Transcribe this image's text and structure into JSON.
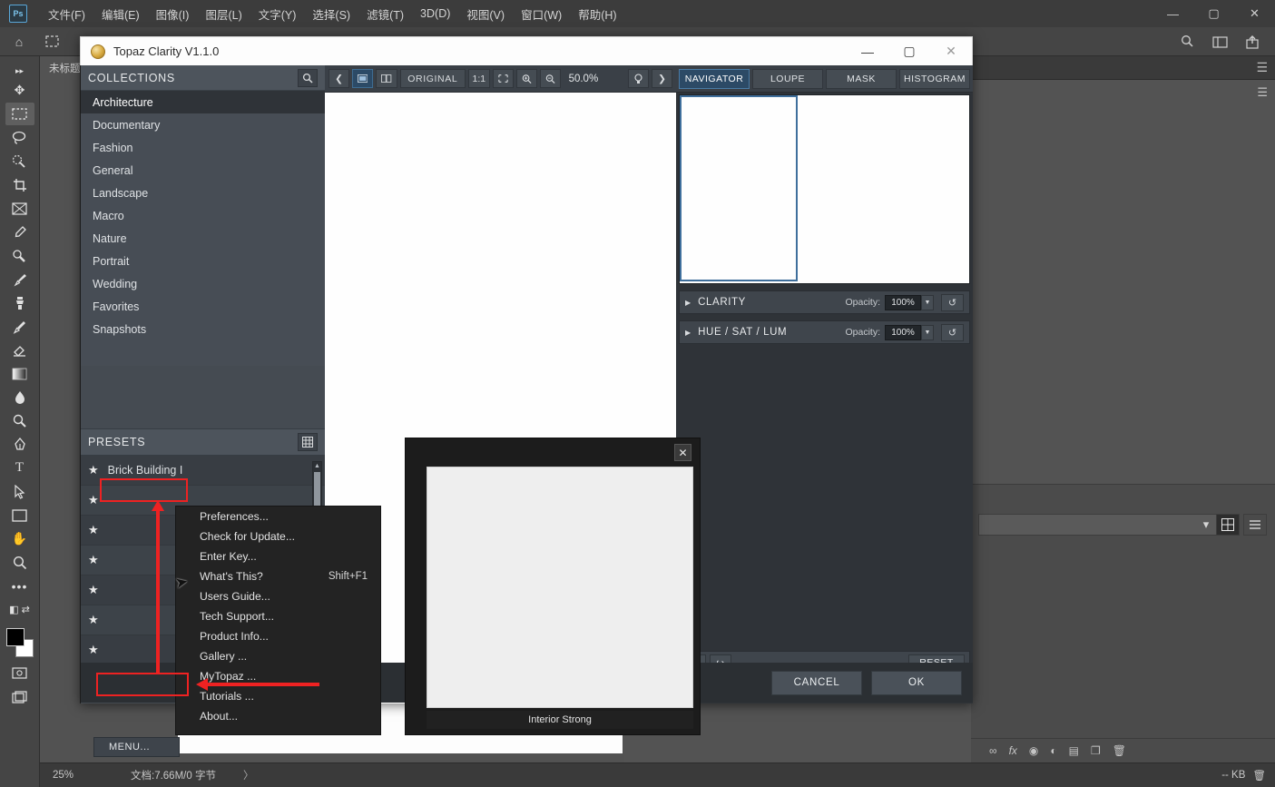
{
  "photoshop": {
    "logo_text": "Ps",
    "menu_items": [
      "文件(F)",
      "编辑(E)",
      "图像(I)",
      "图层(L)",
      "文字(Y)",
      "选择(S)",
      "滤镜(T)",
      "3D(D)",
      "视图(V)",
      "窗口(W)",
      "帮助(H)"
    ],
    "window_controls": {
      "minimize": "—",
      "maximize": "▢",
      "close": "✕"
    },
    "option_bar": {
      "home_icon": "home-icon",
      "marquee_icon": "marquee-icon",
      "dots": "••"
    },
    "tab_title": "未标题",
    "tab_right_icon": "panel-menu-icon",
    "toolbar_icons": [
      "move-tool",
      "rectangular-marquee-tool",
      "lasso-tool",
      "quick-selection-tool",
      "crop-tool",
      "frame-tool",
      "eyedropper-tool",
      "spot-healing-brush-tool",
      "brush-tool",
      "clone-stamp-tool",
      "history-brush-tool",
      "eraser-tool",
      "gradient-tool",
      "blur-tool",
      "dodge-tool",
      "pen-tool",
      "type-tool",
      "path-selection-tool",
      "shape-tool",
      "hand-tool",
      "zoom-tool",
      "more-tools"
    ],
    "option_right_icons": [
      "search-icon",
      "arrange-icon",
      "share-icon"
    ],
    "statusbar": {
      "zoom": "25%",
      "doc_info": "文档:7.66M/0 字节",
      "arrow": "〉",
      "right_label": "-- KB",
      "right_icon": "trash-icon"
    },
    "right_panel": {
      "menu_icon": "panel-options-icon",
      "select_value": "",
      "grid_view_icon": "grid-view-icon",
      "list_view_icon": "list-view-icon",
      "row_labels": [
        "",
        ""
      ],
      "footer_icons": [
        "link-layers-icon",
        "layer-style-icon",
        "layer-mask-icon",
        "adjustment-layer-icon",
        "new-group-icon",
        "new-layer-icon",
        "delete-layer-icon"
      ]
    }
  },
  "topaz": {
    "title": "Topaz Clarity V1.1.0",
    "title_icon": "topaz-logo-icon",
    "window_controls": {
      "minimize": "—",
      "maximize": "▢",
      "close": "✕"
    },
    "collections": {
      "header": "COLLECTIONS",
      "search_icon": "search-icon",
      "items": [
        "Architecture",
        "Documentary",
        "Fashion",
        "General",
        "Landscape",
        "Macro",
        "Nature",
        "Portrait",
        "Wedding",
        "Favorites",
        "Snapshots"
      ],
      "selected_index": 0
    },
    "presets": {
      "header": "PRESETS",
      "grid_icon": "grid-view-icon",
      "items": [
        {
          "name": "Brick Building I",
          "star": "★"
        },
        {
          "name": "",
          "star": "★"
        },
        {
          "name": "",
          "star": "★"
        },
        {
          "name": "",
          "star": "★"
        },
        {
          "name": "",
          "star": "★"
        },
        {
          "name": "",
          "star": "★"
        },
        {
          "name": "",
          "star": "★"
        },
        {
          "name": "",
          "star": "★"
        }
      ],
      "footer_buttons": [
        "save-preset-icon",
        "delete-preset-icon"
      ]
    },
    "image_toolbar": {
      "prev_icon": "chevron-left-icon",
      "single_view_icon": "single-view-icon",
      "split_view_icon": "split-view-icon",
      "original_label": "ORIGINAL",
      "one_to_one_label": "1:1",
      "fit_icon": "fit-to-screen-icon",
      "zoom_in_icon": "zoom-in-icon",
      "zoom_out_icon": "zoom-out-icon",
      "zoom_level": "50.0%",
      "bulb_icon": "preview-bulb-icon",
      "next_icon": "chevron-right-icon"
    },
    "right_tabs": [
      {
        "label": "NAVIGATOR",
        "active": true
      },
      {
        "label": "LOUPE",
        "active": false
      },
      {
        "label": "MASK",
        "active": false
      },
      {
        "label": "HISTOGRAM",
        "active": false
      }
    ],
    "adjustments": [
      {
        "name": "CLARITY",
        "opacity_label": "Opacity:",
        "opacity_value": "100%",
        "reset_icon": "reset-icon",
        "expand_icon": "triangle-right-icon"
      },
      {
        "name": "HUE / SAT / LUM",
        "opacity_label": "Opacity:",
        "opacity_value": "100%",
        "reset_icon": "reset-icon",
        "expand_icon": "triangle-right-icon"
      }
    ],
    "history_bar": {
      "undo_icon": "undo-icon",
      "redo_icon": "redo-icon",
      "reset_label": "RESET"
    },
    "bottom_buttons": [
      {
        "label": "CANCEL",
        "name": "cancel-button"
      },
      {
        "label": "OK",
        "name": "ok-button"
      }
    ],
    "preview_popup": {
      "close_icon": "close-icon",
      "caption": "Interior Strong"
    },
    "menu_button_label": "MENU...",
    "menu_items": [
      {
        "label": "Preferences...",
        "shortcut": ""
      },
      {
        "label": "Check for Update...",
        "shortcut": ""
      },
      {
        "label": "Enter Key...",
        "shortcut": ""
      },
      {
        "label": "What's This?",
        "shortcut": "Shift+F1"
      },
      {
        "label": "Users Guide...",
        "shortcut": ""
      },
      {
        "label": "Tech Support...",
        "shortcut": ""
      },
      {
        "label": "Product Info...",
        "shortcut": ""
      },
      {
        "label": "Gallery ...",
        "shortcut": ""
      },
      {
        "label": "MyTopaz ...",
        "shortcut": ""
      },
      {
        "label": "Tutorials ...",
        "shortcut": ""
      },
      {
        "label": "About...",
        "shortcut": ""
      }
    ]
  },
  "annotations": {
    "highlight_color": "#ee2222",
    "highlighted_menu_item": "Enter Key...",
    "highlighted_button": "MENU..."
  }
}
